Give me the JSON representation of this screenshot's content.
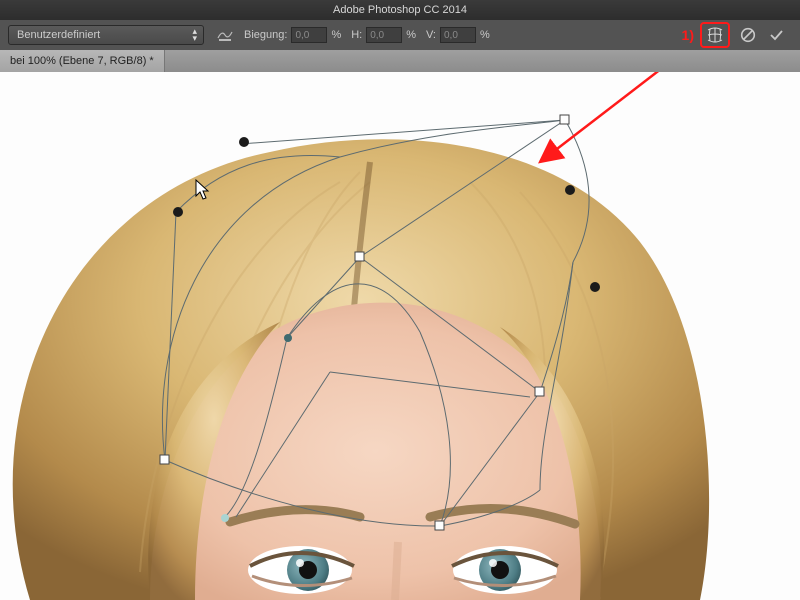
{
  "app_title": "Adobe Photoshop CC 2014",
  "options_bar": {
    "warp_preset": "Benutzerdefiniert",
    "bend_label": "Biegung:",
    "bend_value": "0,0",
    "h_label": "H:",
    "h_value": "0,0",
    "v_label": "V:",
    "v_value": "0,0",
    "percent": "%"
  },
  "annotation": {
    "number_label": "1)"
  },
  "tab": {
    "title": "bei 100% (Ebene 7, RGB/8) *"
  },
  "icons": {
    "warp_grid": "warp-grid-icon",
    "toggle_warp": "toggle-warp-mode-icon",
    "cancel": "cancel-icon",
    "commit": "commit-icon"
  }
}
